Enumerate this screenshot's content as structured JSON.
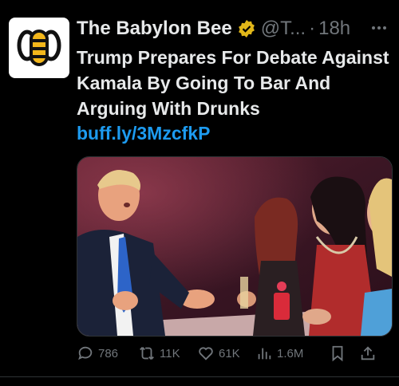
{
  "tweet": {
    "author_name": "The Babylon Bee",
    "handle": "@T...",
    "separator": "·",
    "time": "18h",
    "text": "Trump Prepares For Debate Against Kamala By Going To Bar And Arguing With Drunks",
    "link": "buff.ly/3MzcfkP"
  },
  "media": {
    "description": "photo"
  },
  "actions": {
    "replies": "786",
    "retweets": "11K",
    "likes": "61K",
    "views": "1.6M"
  },
  "colors": {
    "background": "#000000",
    "text": "#e7e9ea",
    "muted": "#71767b",
    "link": "#1d9bf0",
    "verified_badge": "#e2b719",
    "avatar_bee": "#f3b71b"
  },
  "icons": [
    "babylon-bee-logo-icon",
    "verified-badge-icon",
    "more-icon",
    "reply-icon",
    "retweet-icon",
    "like-icon",
    "views-icon",
    "bookmark-icon",
    "share-icon"
  ]
}
